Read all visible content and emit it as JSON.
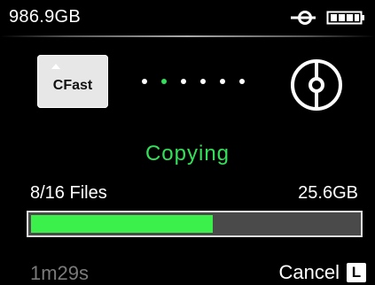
{
  "status_bar": {
    "storage": "986.9GB",
    "connector_icon": "usb-plug-icon",
    "battery_icon": "battery-icon"
  },
  "transfer": {
    "source_icon": "cfast-card-icon",
    "source_label": "CFast",
    "destination_icon": "drive-disk-icon",
    "dots_total": 6,
    "active_dot_index": 1,
    "status": "Copying",
    "files": "8/16 Files",
    "size": "25.6GB",
    "progress_fraction": 0.555,
    "time": "1m29s"
  },
  "actions": {
    "cancel_label": "Cancel",
    "cancel_key": "L"
  },
  "colors": {
    "accent_green": "#33e05a",
    "progress_fill": "#3cf04b",
    "track": "#4a4a4a",
    "muted_text": "#7a7a7a"
  }
}
